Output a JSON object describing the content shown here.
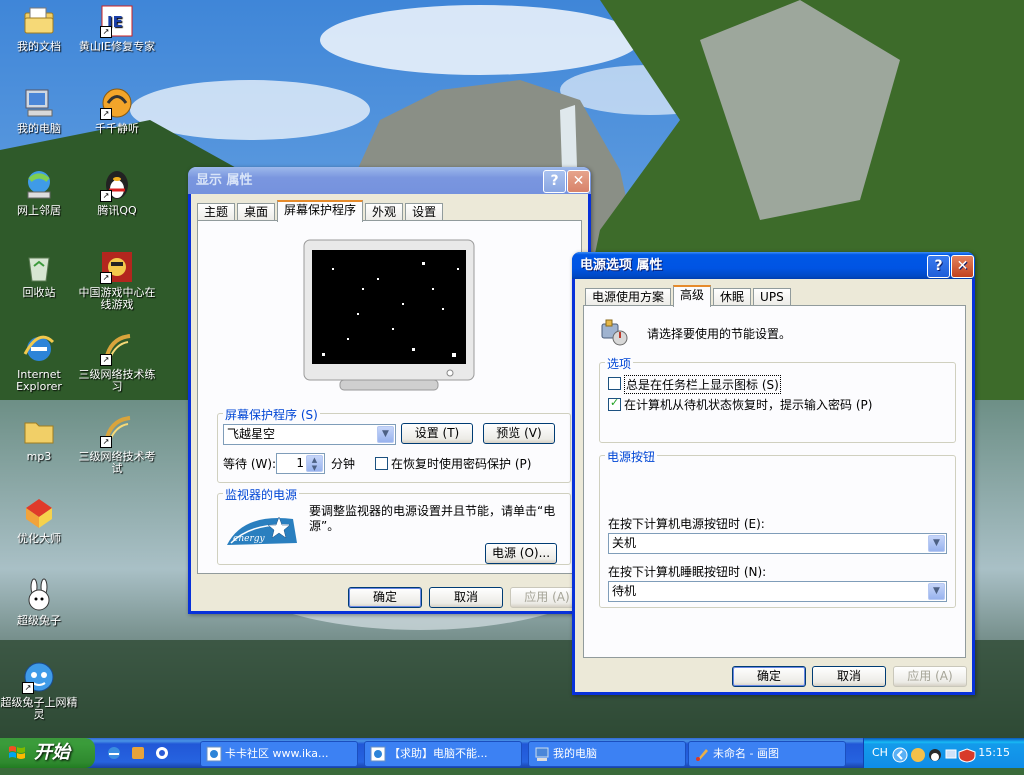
{
  "desktop_icons": [
    {
      "label": "我的文档",
      "icon": "my-documents-icon"
    },
    {
      "label": "黄山IE修复专家",
      "icon": "ie-repair-icon",
      "shortcut": true
    },
    {
      "label": "我的电脑",
      "icon": "my-computer-icon"
    },
    {
      "label": "千千静听",
      "icon": "ttplayer-icon",
      "shortcut": true
    },
    {
      "label": "网上邻居",
      "icon": "network-places-icon"
    },
    {
      "label": "腾讯QQ",
      "icon": "qq-penguin-icon",
      "shortcut": true
    },
    {
      "label": "回收站",
      "icon": "recycle-bin-icon"
    },
    {
      "label": "中国游戏中心在线游戏",
      "icon": "game-center-icon",
      "shortcut": true
    },
    {
      "label": "Internet Explorer",
      "icon": "internet-explorer-icon"
    },
    {
      "label": "三级网络技术练习",
      "icon": "network-practice-icon",
      "shortcut": true
    },
    {
      "label": "mp3",
      "icon": "folder-icon"
    },
    {
      "label": "三级网络技术考试",
      "icon": "network-exam-icon",
      "shortcut": true
    },
    {
      "label": "优化大师",
      "icon": "optimizer-icon"
    },
    {
      "label": "超级兔子",
      "icon": "super-rabbit-icon"
    },
    {
      "label": "超级兔子上网精灵",
      "icon": "rabbit-browser-icon",
      "shortcut": true
    }
  ],
  "display_window": {
    "title": "显示 属性",
    "tabs": [
      "主题",
      "桌面",
      "屏幕保护程序",
      "外观",
      "设置"
    ],
    "selected_tab": "屏幕保护程序",
    "screensaver_group_label": "屏幕保护程序 (S)",
    "screensaver_value": "飞越星空",
    "settings_button": "设置 (T)",
    "preview_button": "预览 (V)",
    "wait_label": "等待 (W):",
    "wait_value": "1",
    "wait_unit": "分钟",
    "password_checkbox": "在恢复时使用密码保护 (P)",
    "monitor_group_label": "监视器的电源",
    "monitor_text": "要调整监视器的电源设置并且节能，请单击“电源”。",
    "power_button": "电源 (O)...",
    "ok": "确定",
    "cancel": "取消",
    "apply": "应用 (A)"
  },
  "power_window": {
    "title": "电源选项 属性",
    "tabs": [
      "电源使用方案",
      "高级",
      "休眠",
      "UPS"
    ],
    "selected_tab": "高级",
    "intro": "请选择要使用的节能设置。",
    "options_group": "选项",
    "opt_tray_icon": "总是在任务栏上显示图标 (S)",
    "opt_tray_icon_checked": false,
    "opt_password": "在计算机从待机状态恢复时，提示输入密码 (P)",
    "opt_password_checked": true,
    "power_buttons_group": "电源按钮",
    "power_btn_label": "在按下计算机电源按钮时 (E):",
    "power_btn_value": "关机",
    "sleep_btn_label": "在按下计算机睡眠按钮时 (N):",
    "sleep_btn_value": "待机",
    "ok": "确定",
    "cancel": "取消",
    "apply": "应用 (A)"
  },
  "taskbar": {
    "start_label": "开始",
    "tasks": [
      {
        "label": "卡卡社区 www.ika...",
        "icon": "ie-page-icon"
      },
      {
        "label": "【求助】电脑不能...",
        "icon": "ie-page-icon"
      },
      {
        "label": "我的电脑",
        "icon": "my-computer-icon"
      },
      {
        "label": "未命名 - 画图",
        "icon": "paint-icon"
      }
    ],
    "lang": "CH",
    "clock": "15:15"
  },
  "colors": {
    "xp_blue": "#0054e3",
    "start_green": "#3a9c3a",
    "dialog_bg": "#ece9d8",
    "group_label": "#0046d5"
  }
}
